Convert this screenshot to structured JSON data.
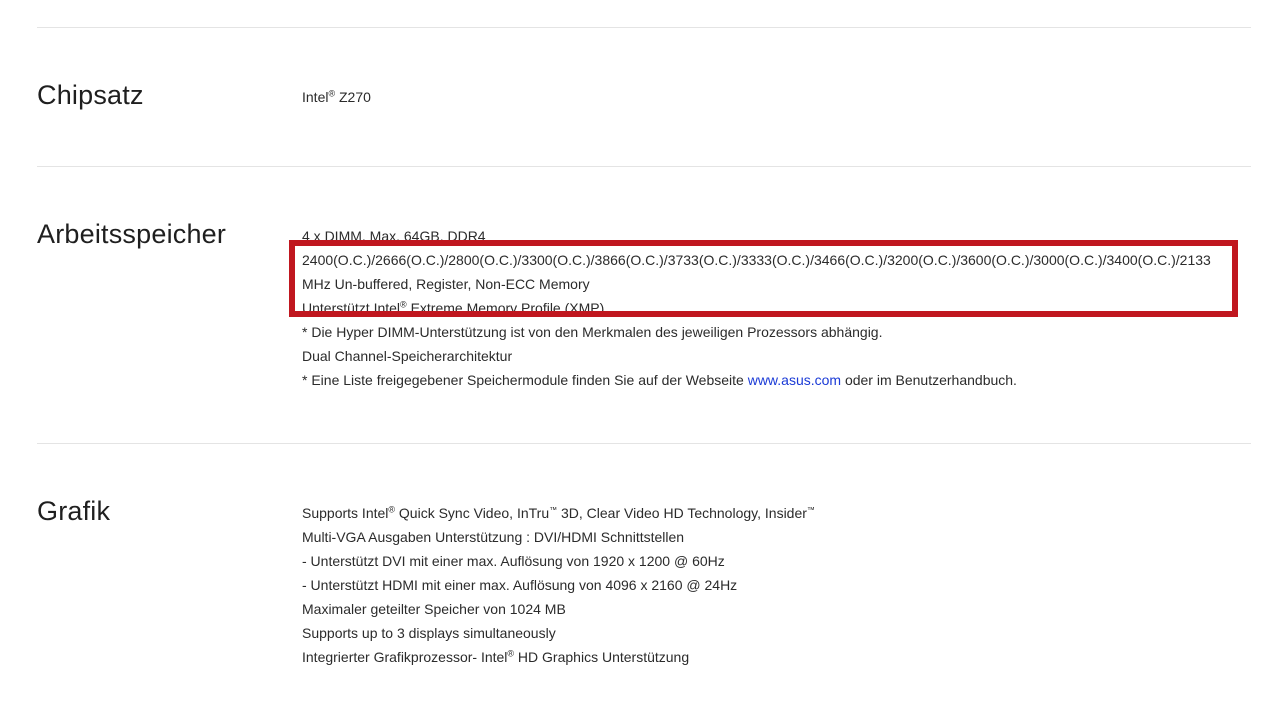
{
  "sections": {
    "chipset": {
      "title": "Chipsatz",
      "vendor": "Intel",
      "reg": "®",
      "model": " Z270"
    },
    "memory": {
      "title": "Arbeitsspeicher",
      "line1": "4 x DIMM, Max. 64GB, DDR4",
      "line2a": "2400(O.C.)/2666(O.C.)/2800(O.C.)/3300(O.C.)/3866(O.C.)/3733(O.C.)/3333(O.C.)/3466(O.C.)/3200(O.C.)/3600(O.C.)/3000(O.C.)/3400(O.C.)/2133",
      "line2b": "MHz Un-buffered, Register, Non-ECC Memory",
      "line3_prefix": "Unterstützt Intel",
      "line3_reg": "®",
      "line3_suffix": " Extreme Memory Profile (XMP)",
      "line4": "* Die Hyper DIMM-Unterstützung ist von den Merkmalen des jeweiligen Prozessors abhängig.",
      "line5": "Dual Channel-Speicherarchitektur",
      "line6_prefix": "* Eine Liste freigegebener Speichermodule finden Sie auf der Webseite ",
      "line6_link": "www.asus.com",
      "line6_suffix": " oder im Benutzerhandbuch."
    },
    "graphics": {
      "title": "Grafik",
      "line1_a": "Supports Intel",
      "line1_reg": "®",
      "line1_b": " Quick Sync Video, InTru",
      "line1_tm1": "™",
      "line1_c": " 3D, Clear Video HD Technology, Insider",
      "line1_tm2": "™",
      "line2": "Multi-VGA Ausgaben Unterstützung : DVI/HDMI Schnittstellen",
      "line3": "- Unterstützt DVI mit einer max. Auflösung von 1920 x 1200 @ 60Hz",
      "line4": "- Unterstützt HDMI mit einer max. Auflösung von 4096 x 2160 @ 24Hz",
      "line5": "Maximaler geteilter Speicher von 1024 MB",
      "line6": "Supports up to 3 displays simultaneously",
      "line7_a": "Integrierter Grafikprozessor- Intel",
      "line7_reg": "®",
      "line7_b": " HD Graphics Unterstützung"
    }
  },
  "highlight": {
    "color": "#c0171f"
  },
  "colors": {
    "text": "#2b2b2b",
    "link": "#1a3ad6",
    "divider": "#e4e4e4"
  }
}
